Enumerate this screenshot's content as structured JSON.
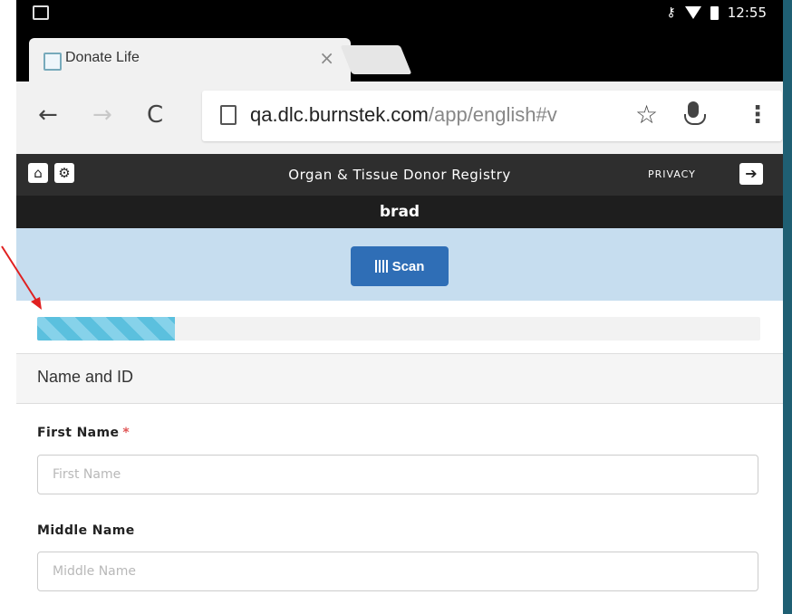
{
  "status_bar": {
    "time": "12:55"
  },
  "tab": {
    "title": "Donate Life",
    "close_symbol": "×"
  },
  "toolbar": {
    "back_symbol": "←",
    "forward_symbol": "→",
    "reload_symbol": "C",
    "url_host": "qa.dlc.burnstek.com",
    "url_path": "/app/english#v",
    "star_symbol": "☆",
    "menu_symbol": "⋮"
  },
  "app": {
    "title": "Organ & Tissue Donor Registry",
    "privacy_label": "PRIVACY",
    "user_name": "brad",
    "scan_label": "Scan",
    "progress_fraction": 0.19
  },
  "form": {
    "section_title": "Name and ID",
    "first_name_label": "First Name",
    "required_marker": "*",
    "first_name_placeholder": "First Name",
    "middle_name_label": "Middle Name",
    "middle_name_placeholder": "Middle Name"
  },
  "colors": {
    "header_bg": "#2e2e2e",
    "scan_band": "#c6ddef",
    "scan_button": "#2f6eb6",
    "progress_fill": "#5bc0de",
    "annotation_arrow": "#e02020"
  }
}
